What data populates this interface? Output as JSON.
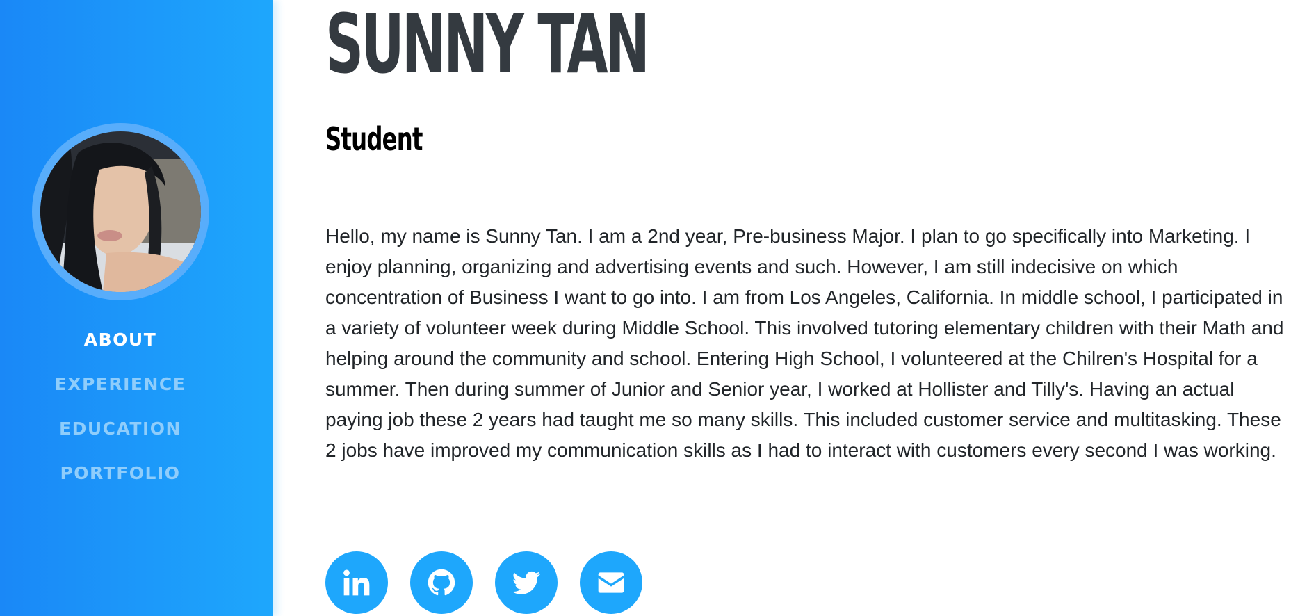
{
  "profile": {
    "name": "SUNNY TAN",
    "role": "Student",
    "bio": "Hello, my name is Sunny Tan. I am a 2nd year, Pre-business Major. I plan to go specifically into Marketing. I enjoy planning, organizing and advertising events and such. However, I am still indecisive on which concentration of Business I want to go into. I am from Los Angeles, California. In middle school, I participated in a variety of volunteer week during Middle School. This involved tutoring elementary children with their Math and helping around the community and school. Entering High School, I volunteered at the Chilren's Hospital for a summer. Then during summer of Junior and Senior year, I worked at Hollister and Tilly's. Having an actual paying job these 2 years had taught me so many skills. This included customer service and multitasking. These 2 jobs have improved my communication skills as I had to interact with customers every second I was working."
  },
  "nav": {
    "items": [
      {
        "label": "ABOUT",
        "active": true
      },
      {
        "label": "EXPERIENCE",
        "active": false
      },
      {
        "label": "EDUCATION",
        "active": false
      },
      {
        "label": "PORTFOLIO",
        "active": false
      }
    ]
  },
  "socials": [
    {
      "icon": "linkedin-icon"
    },
    {
      "icon": "github-icon"
    },
    {
      "icon": "twitter-icon"
    },
    {
      "icon": "envelope-icon"
    }
  ],
  "colors": {
    "sidebar_start": "#1a88f7",
    "sidebar_end": "#1ea7fc",
    "accent": "#1ea7fc",
    "nav_inactive": "#8fcdfb",
    "nav_active": "#ffffff",
    "heading": "#343a40"
  }
}
